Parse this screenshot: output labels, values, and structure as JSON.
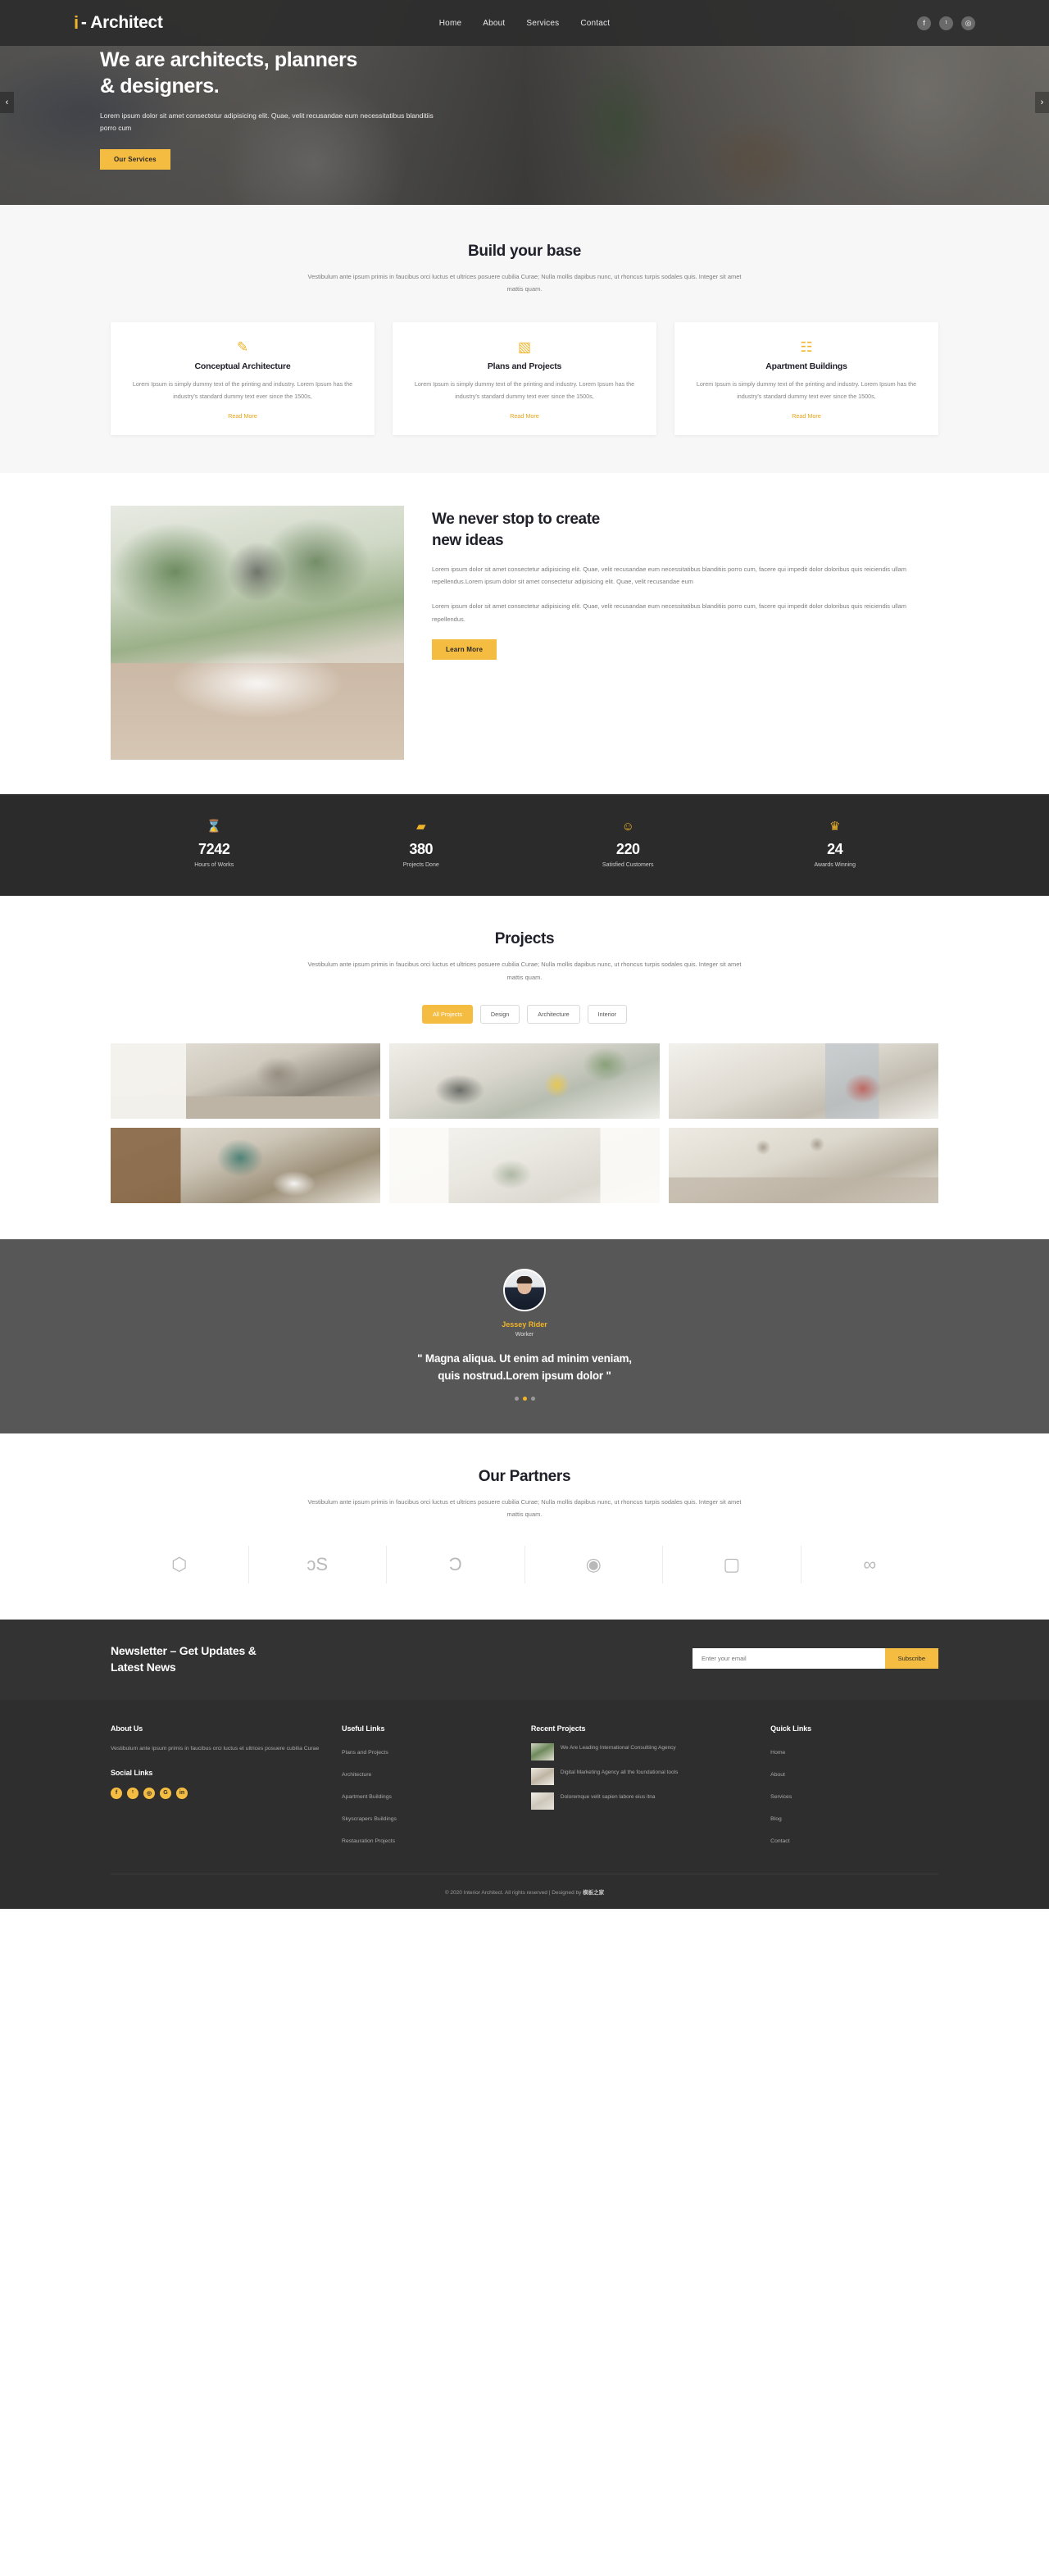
{
  "header": {
    "brand_icon": "i",
    "brand_name": "- Architect",
    "nav": [
      {
        "label": "Home"
      },
      {
        "label": "About"
      },
      {
        "label": "Services"
      },
      {
        "label": "Contact"
      }
    ],
    "social": [
      {
        "name": "facebook-icon",
        "glyph": "f"
      },
      {
        "name": "twitter-icon",
        "glyph": "ᵗ"
      },
      {
        "name": "instagram-icon",
        "glyph": "◎"
      }
    ]
  },
  "hero": {
    "title_line1": "We are architects, planners",
    "title_line2": "& designers.",
    "paragraph": "Lorem ipsum dolor sit amet consectetur adipisicing elit. Quae, velit recusandae eum necessitatibus blanditiis porro cum",
    "cta": "Our Services",
    "prev": "‹",
    "next": "›"
  },
  "services": {
    "title": "Build your base",
    "subtitle": "Vestibulum ante ipsum primis in faucibus orci luctus et ultrices posuere cubilia Curae; Nulla mollis dapibus nunc, ut rhoncus turpis sodales quis. Integer sit amet mattis quam.",
    "cards": [
      {
        "icon": "paintbrush-icon",
        "glyph": "✎",
        "title": "Conceptual Architecture",
        "text": "Lorem Ipsum is simply dummy text of the printing and industry. Lorem Ipsum has the industry's standard dummy text ever since the 1500s,",
        "link": "Read More"
      },
      {
        "icon": "blueprint-icon",
        "glyph": "▧",
        "title": "Plans and Projects",
        "text": "Lorem Ipsum is simply dummy text of the printing and industry. Lorem Ipsum has the industry's standard dummy text ever since the 1500s,",
        "link": "Read More"
      },
      {
        "icon": "building-icon",
        "glyph": "☷",
        "title": "Apartment Buildings",
        "text": "Lorem Ipsum is simply dummy text of the printing and industry. Lorem Ipsum has the industry's standard dummy text ever since the 1500s,",
        "link": "Read More"
      }
    ]
  },
  "ideas": {
    "image_alt": "bathroom-interior-image",
    "title_line1": "We never stop to create",
    "title_line2": "new ideas",
    "paragraph1": "Lorem ipsum dolor sit amet consectetur adipisicing elit. Quae, velit recusandae eum necessitatibus blanditiis porro cum, facere qui impedit dolor doloribus quis reiciendis ullam repellendus.Lorem ipsum dolor sit amet consectetur adipisicing elit. Quae, velit recusandae eum",
    "paragraph2": "Lorem ipsum dolor sit amet consectetur adipisicing elit. Quae, velit recusandae eum necessitatibus blanditiis porro cum, facere qui impedit dolor doloribus quis reiciendis ullam repellendus.",
    "cta": "Learn More"
  },
  "stats": [
    {
      "icon": "hourglass-icon",
      "glyph": "⌛",
      "number": "7242",
      "label": "Hours of Works"
    },
    {
      "icon": "folder-icon",
      "glyph": "▰",
      "number": "380",
      "label": "Projects Done"
    },
    {
      "icon": "smiley-icon",
      "glyph": "☺",
      "number": "220",
      "label": "Satisfied Customers"
    },
    {
      "icon": "trophy-icon",
      "glyph": "♛",
      "number": "24",
      "label": "Awards Winning"
    }
  ],
  "projects": {
    "title": "Projects",
    "subtitle": "Vestibulum ante ipsum primis in faucibus orci luctus et ultrices posuere cubilia Curae; Nulla mollis dapibus nunc, ut rhoncus turpis sodales quis. Integer sit amet mattis quam.",
    "filters": [
      {
        "label": "All Projects",
        "active": true
      },
      {
        "label": "Design",
        "active": false
      },
      {
        "label": "Architecture",
        "active": false
      },
      {
        "label": "Interior",
        "active": false
      }
    ],
    "items": [
      {
        "alt": "kitchen-white-cabinets"
      },
      {
        "alt": "living-room-green-plants"
      },
      {
        "alt": "living-room-red-sofa"
      },
      {
        "alt": "bathroom-teal-wall"
      },
      {
        "alt": "bright-room-curtains"
      },
      {
        "alt": "kitchen-pendant-lamps"
      }
    ]
  },
  "testimonial": {
    "avatar_alt": "jessey-rider-portrait",
    "name": "Jessey Rider",
    "role": "Worker",
    "quote_line1": "\" Magna aliqua. Ut enim ad minim veniam,",
    "quote_line2": "quis nostrud.Lorem ipsum dolor \"",
    "active_dot": 2,
    "dot_count": 3
  },
  "partners": {
    "title": "Our Partners",
    "subtitle": "Vestibulum ante ipsum primis in faucibus orci luctus et ultrices posuere cubilia Curae; Nulla mollis dapibus nunc, ut rhoncus turpis sodales quis. Integer sit amet mattis quam.",
    "logos": [
      {
        "name": "diamond-cube-logo",
        "glyph": "⬡"
      },
      {
        "name": "lastfm-logo",
        "glyph": "ɔS"
      },
      {
        "name": "swirl-c-logo",
        "glyph": "Ɔ"
      },
      {
        "name": "droplet-logo",
        "glyph": "◉"
      },
      {
        "name": "box-logo",
        "glyph": "▢"
      },
      {
        "name": "infinity-logo",
        "glyph": "∞"
      }
    ]
  },
  "newsletter": {
    "title_line1": "Newsletter – Get Updates &",
    "title_line2": "Latest News",
    "placeholder": "Enter your email",
    "value": "",
    "button": "Subscribe"
  },
  "footer": {
    "about": {
      "heading": "About Us",
      "text": "Vestibulum ante ipsum primis in faucibus orci luctus et ultrices posuere cubilia Curae",
      "social_heading": "Social Links",
      "social": [
        {
          "name": "facebook-icon",
          "glyph": "f"
        },
        {
          "name": "twitter-icon",
          "glyph": "ᵗ"
        },
        {
          "name": "instagram-icon",
          "glyph": "◎"
        },
        {
          "name": "google-plus-icon",
          "glyph": "G"
        },
        {
          "name": "linkedin-icon",
          "glyph": "in"
        }
      ]
    },
    "useful": {
      "heading": "Useful Links",
      "links": [
        {
          "label": "Plans and Projects"
        },
        {
          "label": "Architecture"
        },
        {
          "label": "Apartment Buildings"
        },
        {
          "label": "Skyscrapers Buildings"
        },
        {
          "label": "Restauration Projects"
        }
      ]
    },
    "recent": {
      "heading": "Recent Projects",
      "items": [
        {
          "thumb": "project-thumb-1",
          "text": "We Are Leading International Consultiing Agency"
        },
        {
          "thumb": "project-thumb-2",
          "text": "Digital Marketing Agency all the foundational tools"
        },
        {
          "thumb": "project-thumb-3",
          "text": "Doloremque velit sapien labore eius itna"
        }
      ]
    },
    "quick": {
      "heading": "Quick Links",
      "links": [
        {
          "label": "Home"
        },
        {
          "label": "About"
        },
        {
          "label": "Services"
        },
        {
          "label": "Blog"
        },
        {
          "label": "Contact"
        }
      ]
    },
    "copyright_text": "© 2020 Interior Architect. All rights reserved | Designed by ",
    "copyright_brand": "模板之家"
  },
  "colors": {
    "accent": "#f5bc42",
    "accent_text": "#e8a317",
    "dark": "#2b2b2b",
    "footer_bg": "#2e2e2e",
    "testimonial_bg": "#575757",
    "light_bg": "#f7f7f7"
  }
}
